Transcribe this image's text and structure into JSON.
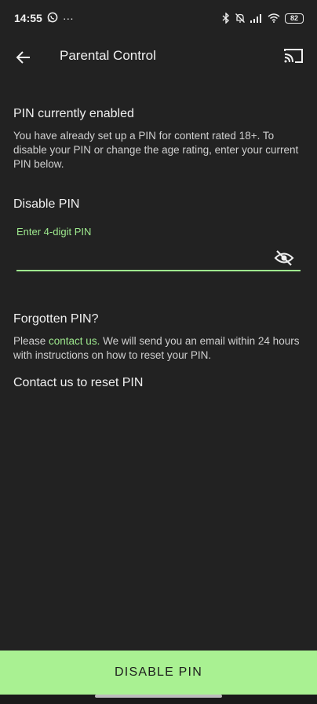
{
  "status_bar": {
    "time": "14:55",
    "more_indicator": "···",
    "battery_level": "82",
    "icons": [
      "whatsapp-icon",
      "bluetooth-icon",
      "bell-off-icon",
      "signal-icon",
      "wifi-icon",
      "battery-icon"
    ]
  },
  "app_bar": {
    "title": "Parental Control",
    "back_icon": "back-arrow-icon",
    "cast_icon": "cast-icon"
  },
  "pin_section": {
    "title": "PIN currently enabled",
    "description": "You have already set up a PIN for content rated 18+. To disable your PIN or change the age rating, enter your current PIN below."
  },
  "disable_section": {
    "title": "Disable PIN",
    "input_label": "Enter 4-digit PIN",
    "input_value": "",
    "visibility_icon": "eye-off-icon"
  },
  "forgotten_section": {
    "title": "Forgotten PIN?",
    "text_before": "Please ",
    "link_text": "contact us.",
    "text_after": " We will send you an email within 24 hours with instructions on how to reset your PIN."
  },
  "contact_link": "Contact us to reset PIN",
  "bottom_button": {
    "label": "DISABLE PIN"
  },
  "colors": {
    "background": "#222222",
    "accent": "#9ee98e",
    "button_bg": "#a9f192",
    "text": "#f0f0f0"
  }
}
